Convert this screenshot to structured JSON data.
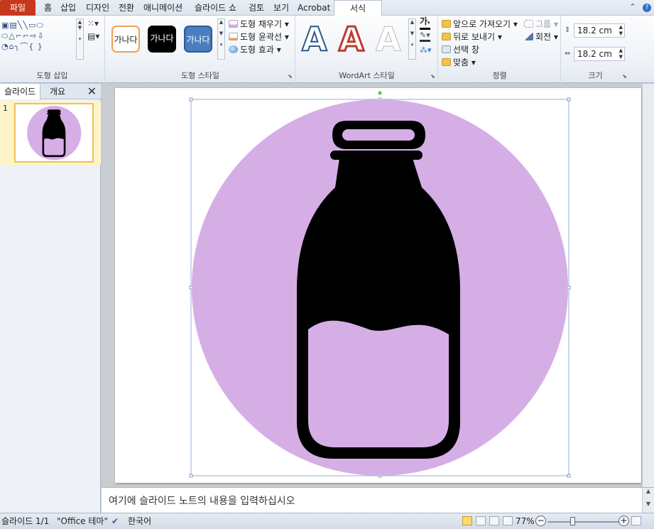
{
  "tabs": {
    "file": "파일",
    "home": "홈",
    "insert": "삽입",
    "design": "디자인",
    "transitions": "전환",
    "animations": "애니메이션",
    "slideshow": "슬라이드 쇼",
    "review": "검토",
    "view": "보기",
    "acrobat": "Acrobat",
    "format": "서식"
  },
  "ribbon": {
    "insert_shapes": {
      "label": "도형 삽입"
    },
    "shape_styles": {
      "label": "도형 스타일",
      "preset_text": "가나다",
      "fill": "도형 채우기",
      "outline": "도형 윤곽선",
      "effects": "도형 효과"
    },
    "wordart_styles": {
      "label": "WordArt 스타일",
      "sample_letter": "A",
      "text_fill_glyph": "가"
    },
    "arrange": {
      "label": "정렬",
      "bring_forward": "앞으로 가져오기",
      "send_backward": "뒤로 보내기",
      "selection_pane": "선택 창",
      "align": "맞춤",
      "group": "그룹",
      "rotate": "회전"
    },
    "size": {
      "label": "크기",
      "height": "18.2 cm",
      "width": "18.2 cm"
    }
  },
  "left_panel": {
    "tab_slides": "슬라이드",
    "tab_outline": "개요",
    "close": "✕",
    "slide_number": "1"
  },
  "notes": {
    "placeholder": "여기에 슬라이드 노트의 내용을 입력하십시오"
  },
  "status": {
    "slide_count": "슬라이드 1/1",
    "theme": "\"Office 테마\"",
    "language": "한국어",
    "zoom": "77%"
  },
  "colors": {
    "circle": "#d6aee6",
    "bottle": "#000000",
    "accent_file_tab": "#c5381c",
    "selection": "#8fb0d8"
  }
}
